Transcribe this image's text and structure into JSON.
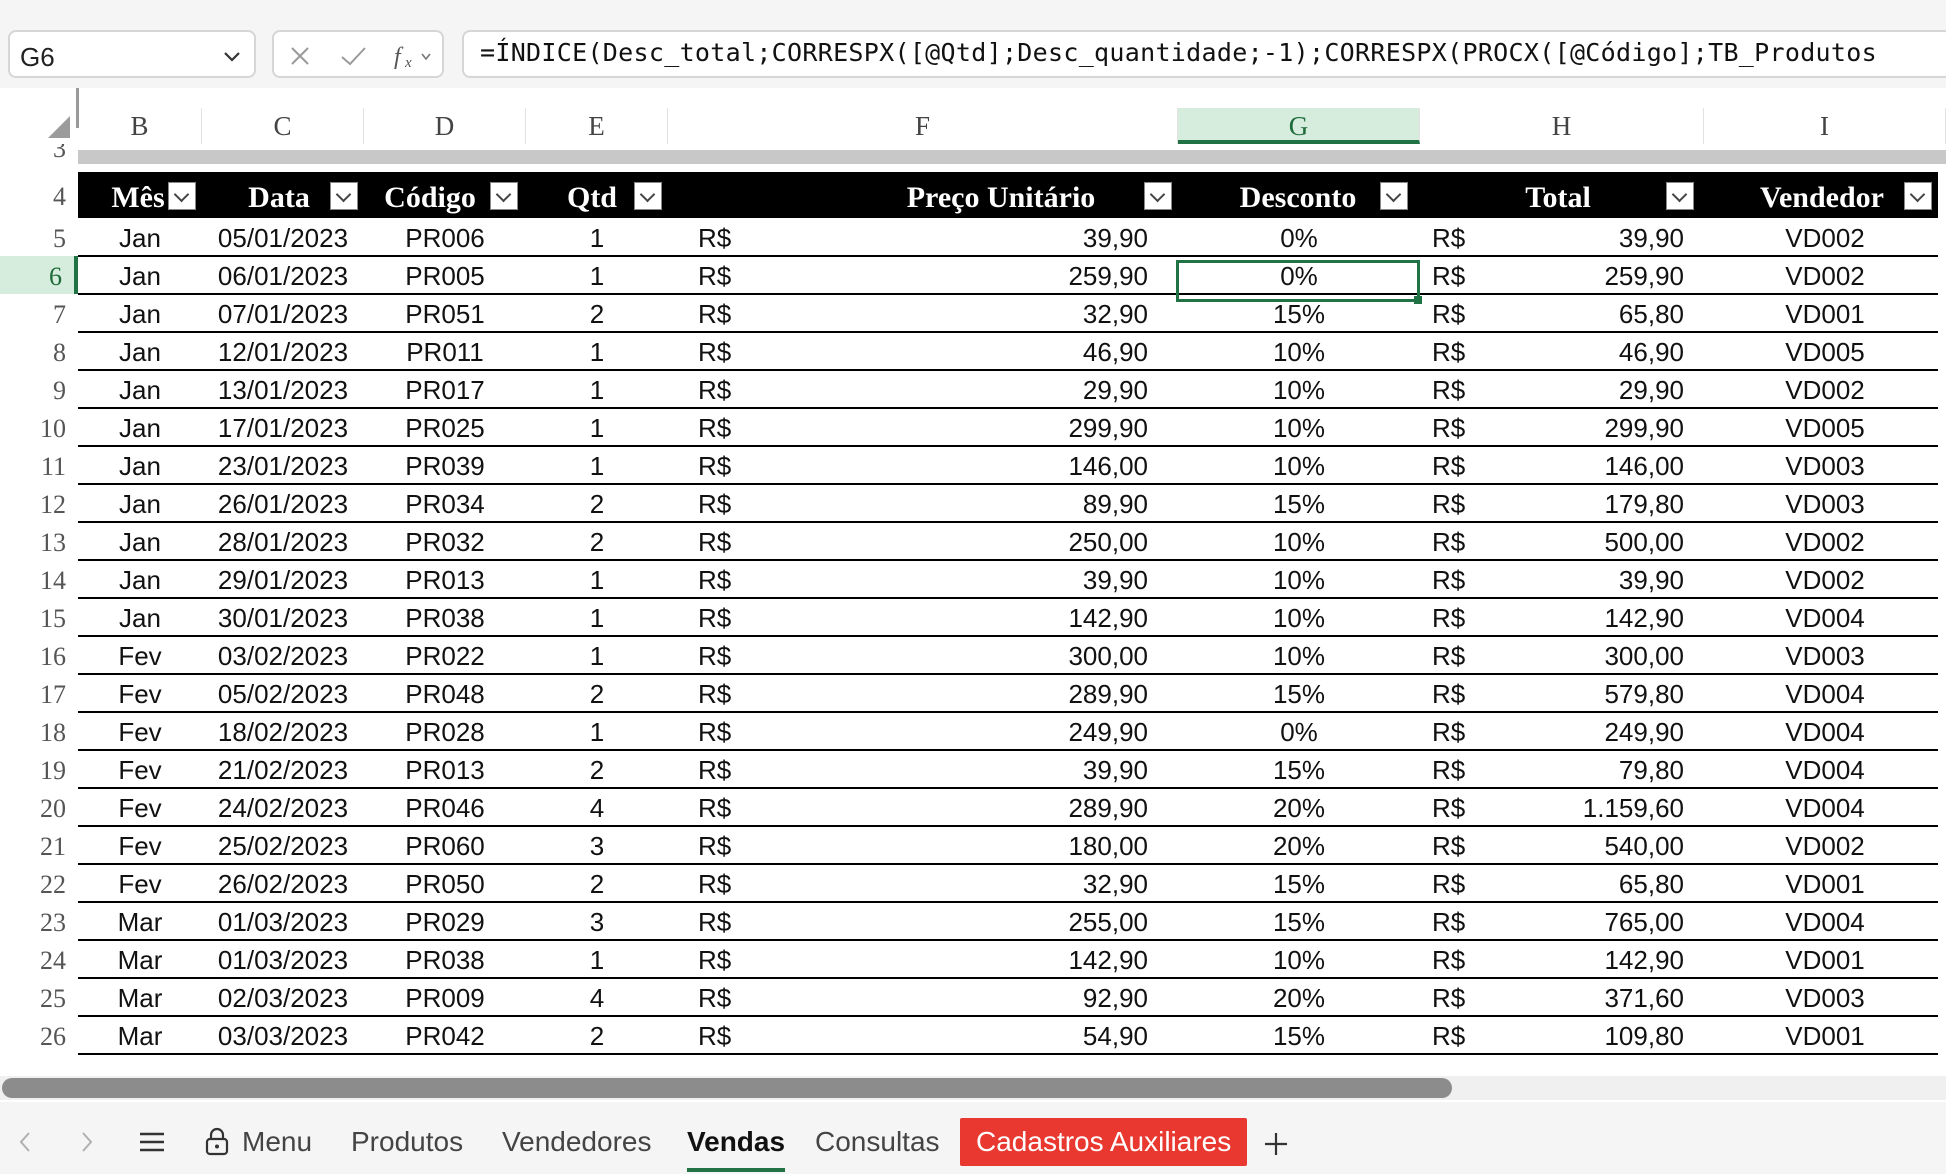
{
  "formula_bar": {
    "name_box": "G6",
    "formula": "=ÍNDICE(Desc_total;CORRESPX([@Qtd];Desc_quantidade;-1);CORRESPX(PROCX([@Código];TB_Produtos"
  },
  "columns": [
    "B",
    "C",
    "D",
    "E",
    "F",
    "G",
    "H",
    "I"
  ],
  "selected_column": "G",
  "row_numbers": [
    "4",
    "5",
    "6",
    "7",
    "8",
    "9",
    "10",
    "11",
    "12",
    "13",
    "14",
    "15",
    "16",
    "17",
    "18",
    "19",
    "20",
    "21",
    "22",
    "23",
    "24",
    "25",
    "26"
  ],
  "partial_row_number": "3",
  "selected_row": "6",
  "table": {
    "headers": {
      "mes": "Mês",
      "data": "Data",
      "codigo": "Código",
      "qtd": "Qtd",
      "preco": "Preço Unitário",
      "desconto": "Desconto",
      "total": "Total",
      "vendedor": "Vendedor"
    },
    "currency": "R$",
    "rows": [
      {
        "mes": "Jan",
        "data": "05/01/2023",
        "codigo": "PR006",
        "qtd": "1",
        "preco": "39,90",
        "desconto": "0%",
        "total": "39,90",
        "vendedor": "VD002"
      },
      {
        "mes": "Jan",
        "data": "06/01/2023",
        "codigo": "PR005",
        "qtd": "1",
        "preco": "259,90",
        "desconto": "0%",
        "total": "259,90",
        "vendedor": "VD002"
      },
      {
        "mes": "Jan",
        "data": "07/01/2023",
        "codigo": "PR051",
        "qtd": "2",
        "preco": "32,90",
        "desconto": "15%",
        "total": "65,80",
        "vendedor": "VD001"
      },
      {
        "mes": "Jan",
        "data": "12/01/2023",
        "codigo": "PR011",
        "qtd": "1",
        "preco": "46,90",
        "desconto": "10%",
        "total": "46,90",
        "vendedor": "VD005"
      },
      {
        "mes": "Jan",
        "data": "13/01/2023",
        "codigo": "PR017",
        "qtd": "1",
        "preco": "29,90",
        "desconto": "10%",
        "total": "29,90",
        "vendedor": "VD002"
      },
      {
        "mes": "Jan",
        "data": "17/01/2023",
        "codigo": "PR025",
        "qtd": "1",
        "preco": "299,90",
        "desconto": "10%",
        "total": "299,90",
        "vendedor": "VD005"
      },
      {
        "mes": "Jan",
        "data": "23/01/2023",
        "codigo": "PR039",
        "qtd": "1",
        "preco": "146,00",
        "desconto": "10%",
        "total": "146,00",
        "vendedor": "VD003"
      },
      {
        "mes": "Jan",
        "data": "26/01/2023",
        "codigo": "PR034",
        "qtd": "2",
        "preco": "89,90",
        "desconto": "15%",
        "total": "179,80",
        "vendedor": "VD003"
      },
      {
        "mes": "Jan",
        "data": "28/01/2023",
        "codigo": "PR032",
        "qtd": "2",
        "preco": "250,00",
        "desconto": "10%",
        "total": "500,00",
        "vendedor": "VD002"
      },
      {
        "mes": "Jan",
        "data": "29/01/2023",
        "codigo": "PR013",
        "qtd": "1",
        "preco": "39,90",
        "desconto": "10%",
        "total": "39,90",
        "vendedor": "VD002"
      },
      {
        "mes": "Jan",
        "data": "30/01/2023",
        "codigo": "PR038",
        "qtd": "1",
        "preco": "142,90",
        "desconto": "10%",
        "total": "142,90",
        "vendedor": "VD004"
      },
      {
        "mes": "Fev",
        "data": "03/02/2023",
        "codigo": "PR022",
        "qtd": "1",
        "preco": "300,00",
        "desconto": "10%",
        "total": "300,00",
        "vendedor": "VD003"
      },
      {
        "mes": "Fev",
        "data": "05/02/2023",
        "codigo": "PR048",
        "qtd": "2",
        "preco": "289,90",
        "desconto": "15%",
        "total": "579,80",
        "vendedor": "VD004"
      },
      {
        "mes": "Fev",
        "data": "18/02/2023",
        "codigo": "PR028",
        "qtd": "1",
        "preco": "249,90",
        "desconto": "0%",
        "total": "249,90",
        "vendedor": "VD004"
      },
      {
        "mes": "Fev",
        "data": "21/02/2023",
        "codigo": "PR013",
        "qtd": "2",
        "preco": "39,90",
        "desconto": "15%",
        "total": "79,80",
        "vendedor": "VD004"
      },
      {
        "mes": "Fev",
        "data": "24/02/2023",
        "codigo": "PR046",
        "qtd": "4",
        "preco": "289,90",
        "desconto": "20%",
        "total": "1.159,60",
        "vendedor": "VD004"
      },
      {
        "mes": "Fev",
        "data": "25/02/2023",
        "codigo": "PR060",
        "qtd": "3",
        "preco": "180,00",
        "desconto": "20%",
        "total": "540,00",
        "vendedor": "VD002"
      },
      {
        "mes": "Fev",
        "data": "26/02/2023",
        "codigo": "PR050",
        "qtd": "2",
        "preco": "32,90",
        "desconto": "15%",
        "total": "65,80",
        "vendedor": "VD001"
      },
      {
        "mes": "Mar",
        "data": "01/03/2023",
        "codigo": "PR029",
        "qtd": "3",
        "preco": "255,00",
        "desconto": "15%",
        "total": "765,00",
        "vendedor": "VD004"
      },
      {
        "mes": "Mar",
        "data": "01/03/2023",
        "codigo": "PR038",
        "qtd": "1",
        "preco": "142,90",
        "desconto": "10%",
        "total": "142,90",
        "vendedor": "VD001"
      },
      {
        "mes": "Mar",
        "data": "02/03/2023",
        "codigo": "PR009",
        "qtd": "4",
        "preco": "92,90",
        "desconto": "20%",
        "total": "371,60",
        "vendedor": "VD003"
      },
      {
        "mes": "Mar",
        "data": "03/03/2023",
        "codigo": "PR042",
        "qtd": "2",
        "preco": "54,90",
        "desconto": "15%",
        "total": "109,80",
        "vendedor": "VD001"
      }
    ]
  },
  "sheet_tabs": {
    "menu": "Menu",
    "items": [
      "Produtos",
      "Vendedores",
      "Vendas",
      "Consultas",
      "Cadastros Auxiliares"
    ],
    "active": "Vendas",
    "highlighted": "Cadastros Auxiliares",
    "highlight_color": "#e8382f"
  },
  "colors": {
    "accent": "#217346",
    "header_bg": "#000000"
  },
  "icons": [
    "chevron-down-icon",
    "cancel-x-icon",
    "check-icon",
    "function-fx-icon",
    "lock-icon",
    "hamburger-icon",
    "chevron-left-icon",
    "chevron-right-icon",
    "plus-icon"
  ]
}
